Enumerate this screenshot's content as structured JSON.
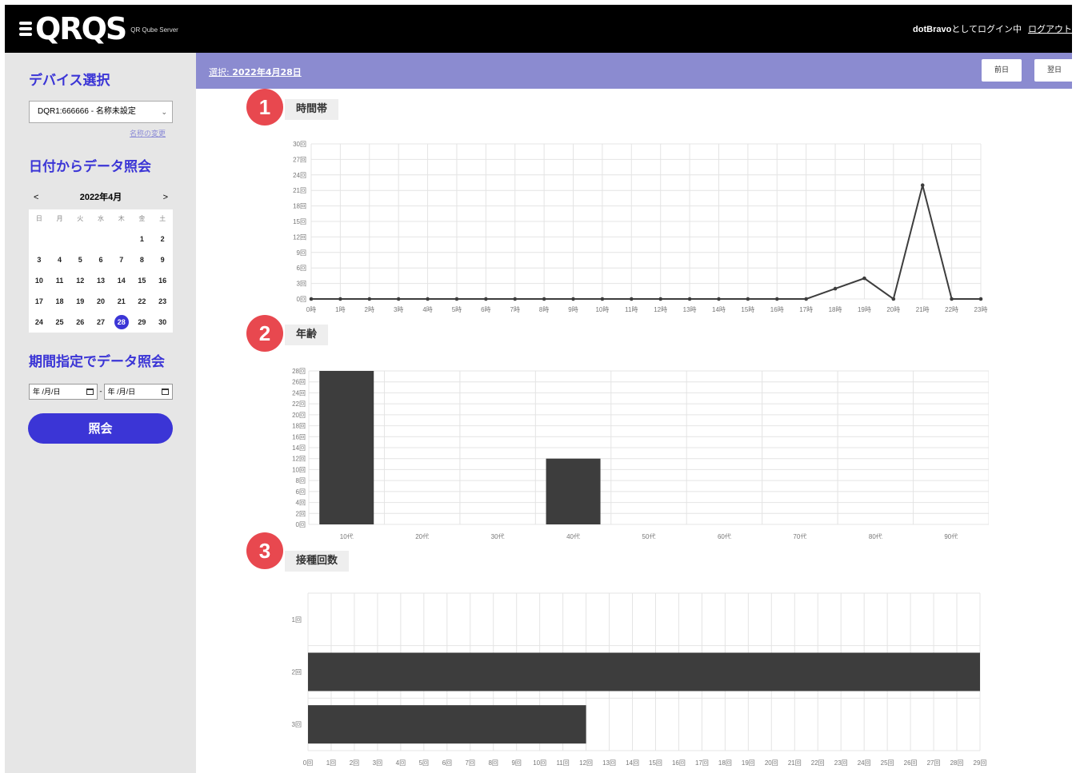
{
  "header": {
    "logo_text": "QRQS",
    "logo_subtitle": "QR Qube Server",
    "user": "dotBravo",
    "login_suffix": "としてログイン中",
    "logout": "ログアウト"
  },
  "sidebar": {
    "device_heading": "デバイス選択",
    "device_selected": "DQR1:666666 - 名称未設定",
    "rename_link": "名称の変更",
    "date_heading": "日付からデータ照会",
    "calendar": {
      "prev": "<",
      "next": ">",
      "month_label": "2022年4月",
      "weekdays": [
        "日",
        "月",
        "火",
        "水",
        "木",
        "金",
        "土"
      ],
      "days": [
        "",
        "",
        "",
        "",
        "",
        "1",
        "2",
        "3",
        "4",
        "5",
        "6",
        "7",
        "8",
        "9",
        "10",
        "11",
        "12",
        "13",
        "14",
        "15",
        "16",
        "17",
        "18",
        "19",
        "20",
        "21",
        "22",
        "23",
        "24",
        "25",
        "26",
        "27",
        "28",
        "29",
        "30"
      ],
      "selected_day": "28"
    },
    "range_heading": "期間指定でデータ照会",
    "range_start_placeholder": "年 /月/日",
    "range_end_placeholder": "年 /月/日",
    "range_dash": "-",
    "query_button": "照会"
  },
  "main": {
    "selected_prefix": "選択: ",
    "selected_date": "2022年4月28日",
    "prev_button": "前日",
    "next_button": "翌日"
  },
  "sections": [
    {
      "badge": "1",
      "label": "時間帯"
    },
    {
      "badge": "2",
      "label": "年齢"
    },
    {
      "badge": "3",
      "label": "接種回数"
    }
  ],
  "colors": {
    "accent": "#3b35d6",
    "header_bg": "#000000",
    "sidebar_bg": "#e6e6e6",
    "date_bar": "#8b8bd0",
    "badge": "#e8484f",
    "bar": "#3d3d3d"
  },
  "chart_data": [
    {
      "type": "line",
      "x": [
        "0時",
        "1時",
        "2時",
        "3時",
        "4時",
        "5時",
        "6時",
        "7時",
        "8時",
        "9時",
        "10時",
        "11時",
        "12時",
        "13時",
        "14時",
        "15時",
        "16時",
        "17時",
        "18時",
        "19時",
        "20時",
        "21時",
        "22時",
        "23時"
      ],
      "values": [
        0,
        0,
        0,
        0,
        0,
        0,
        0,
        0,
        0,
        0,
        0,
        0,
        0,
        0,
        0,
        0,
        0,
        0,
        2,
        4,
        0,
        22,
        0,
        0
      ],
      "ylim": [
        0,
        22
      ],
      "yticks": [
        "0回",
        "3回",
        "6回",
        "9回",
        "12回",
        "15回",
        "18回",
        "21回",
        "24回",
        "27回",
        "30回"
      ],
      "grid": true
    },
    {
      "type": "bar",
      "categories": [
        "10代",
        "20代",
        "30代",
        "40代",
        "50代",
        "60代",
        "70代",
        "80代",
        "90代"
      ],
      "values": [
        28,
        0,
        0,
        12,
        0,
        0,
        0,
        0,
        0
      ],
      "ylim": [
        0,
        28
      ],
      "yticks": [
        "0回",
        "2回",
        "4回",
        "6回",
        "8回",
        "10回",
        "12回",
        "14回",
        "16回",
        "18回",
        "20回",
        "22回",
        "24回",
        "26回",
        "28回"
      ],
      "grid": true
    },
    {
      "type": "bar",
      "orientation": "horizontal",
      "categories": [
        "1回",
        "2回",
        "3回"
      ],
      "values": [
        0,
        29,
        12
      ],
      "xlim": [
        0,
        29
      ],
      "xticks": [
        "0回",
        "1回",
        "2回",
        "3回",
        "4回",
        "5回",
        "6回",
        "7回",
        "8回",
        "9回",
        "10回",
        "11回",
        "12回",
        "13回",
        "14回",
        "15回",
        "16回",
        "17回",
        "18回",
        "19回",
        "20回",
        "21回",
        "22回",
        "23回",
        "24回",
        "25回",
        "26回",
        "27回",
        "28回",
        "29回"
      ],
      "grid": true
    }
  ]
}
